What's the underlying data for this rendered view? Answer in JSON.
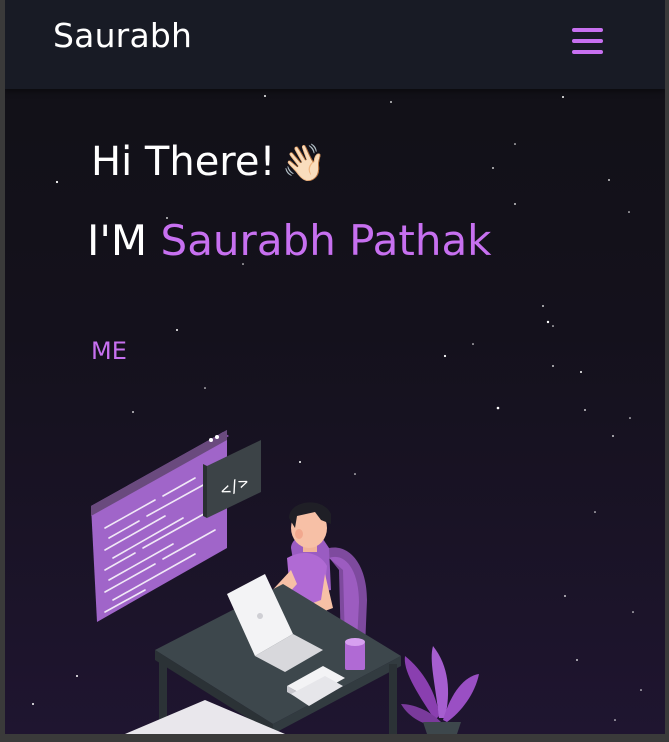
{
  "navbar": {
    "brand": "Saurabh",
    "menu_icon": "hamburger-menu-icon",
    "menu_color": "#c770f0"
  },
  "hero": {
    "greeting": "Hi There!",
    "wave_emoji": "👋🏻",
    "intro_prefix": "I'M",
    "name": "Saurabh Pathak",
    "typed_text": "ME",
    "accent_color": "#c770f0",
    "illustration_icon": "developer-at-desk-illustration",
    "code_badge": "</>"
  }
}
